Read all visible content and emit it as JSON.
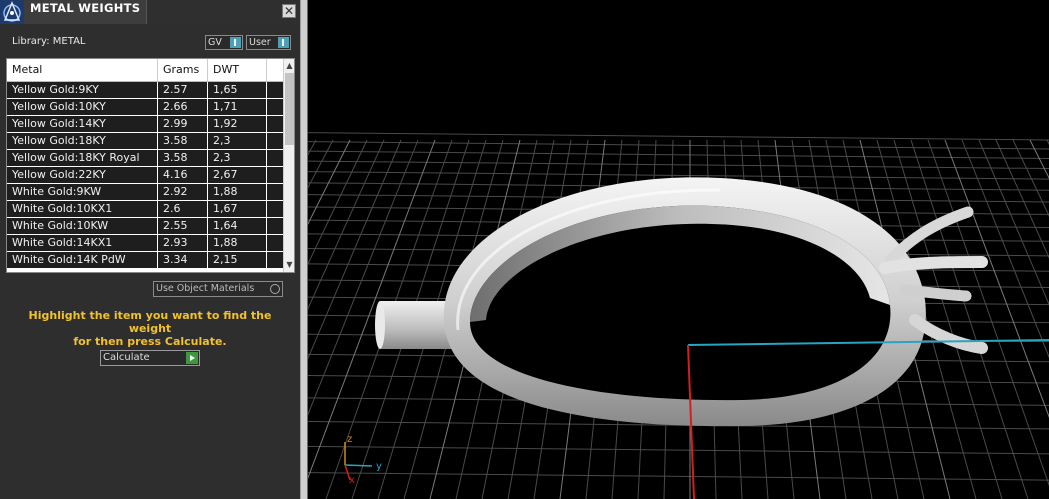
{
  "window": {
    "title": "METAL WEIGHTS",
    "close_glyph": "✕",
    "logo_icon": "app-logo-icon"
  },
  "library": {
    "label": "Library: METAL",
    "gv_label": "GV",
    "user_label": "User"
  },
  "table": {
    "columns": [
      "Metal",
      "Grams",
      "DWT"
    ],
    "rows": [
      [
        "Yellow Gold:9KY",
        "2.57",
        "1,65"
      ],
      [
        "Yellow Gold:10KY",
        "2.66",
        "1,71"
      ],
      [
        "Yellow Gold:14KY",
        "2.99",
        "1,92"
      ],
      [
        "Yellow Gold:18KY",
        "3.58",
        "2,3"
      ],
      [
        "Yellow Gold:18KY Royal",
        "3.58",
        "2,3"
      ],
      [
        "Yellow Gold:22KY",
        "4.16",
        "2,67"
      ],
      [
        "White Gold:9KW",
        "2.92",
        "1,88"
      ],
      [
        "White Gold:10KX1",
        "2.6",
        "1,67"
      ],
      [
        "White Gold:10KW",
        "2.55",
        "1,64"
      ],
      [
        "White Gold:14KX1",
        "2.93",
        "1,88"
      ],
      [
        "White Gold:14K PdW",
        "3.34",
        "2,15"
      ]
    ]
  },
  "options": {
    "use_object_materials": "Use Object Materials"
  },
  "hint": {
    "line1": "Highlight the item you want to find the weight",
    "line2": "for then press Calculate."
  },
  "actions": {
    "calculate_label": "Calculate"
  },
  "viewport": {
    "axis_z": "z",
    "axis_y": "y",
    "axis_x": "x",
    "colors": {
      "x_axis": "#d02020",
      "y_axis": "#2aa3c0",
      "z_axis": "#d08a20",
      "grid": "#4a4a4a",
      "grid_major": "#7a7a7a"
    }
  }
}
